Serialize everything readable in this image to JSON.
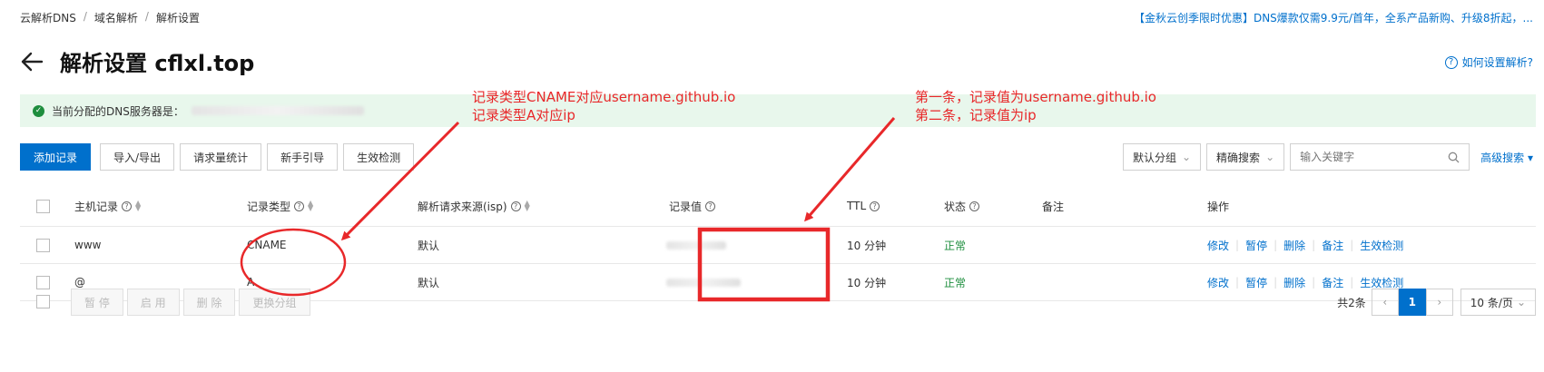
{
  "breadcrumb": [
    "云解析DNS",
    "域名解析",
    "解析设置"
  ],
  "breadcrumb_sep": "/",
  "promo": "【金秋云创季限时优惠】DNS爆款仅需9.9元/首年，全系产品新购、升级8折起，...",
  "page_title": "解析设置 cflxl.top",
  "help_link": "如何设置解析?",
  "dns_banner": {
    "text": "当前分配的DNS服务器是："
  },
  "toolbar": {
    "add": "添加记录",
    "import_export": "导入/导出",
    "request_stats": "请求量统计",
    "guide": "新手引导",
    "check": "生效检测"
  },
  "filters": {
    "group": "默认分组",
    "search_mode": "精确搜索",
    "search_placeholder": "输入关键字",
    "advanced": "高级搜索"
  },
  "table": {
    "headers": {
      "host": "主机记录",
      "type": "记录类型",
      "isp": "解析请求来源(isp)",
      "value": "记录值",
      "ttl": "TTL",
      "status": "状态",
      "remark": "备注",
      "ops": "操作"
    },
    "rows": [
      {
        "host": "www",
        "type": "CNAME",
        "isp": "默认",
        "ttl": "10 分钟",
        "status": "正常"
      },
      {
        "host": "@",
        "type": "A",
        "isp": "默认",
        "ttl": "10 分钟",
        "status": "正常"
      }
    ],
    "ops": [
      "修改",
      "暂停",
      "删除",
      "备注",
      "生效检测"
    ]
  },
  "bulk": {
    "pause": "暂 停",
    "enable": "启 用",
    "delete": "删 除",
    "regroup": "更换分组"
  },
  "pagination": {
    "total": "共2条",
    "current": "1",
    "page_size": "10 条/页"
  },
  "annotations": {
    "left_line1": "记录类型CNAME对应username.github.io",
    "left_line2": "记录类型A对应ip",
    "right_line1": "第一条，记录值为username.github.io",
    "right_line2": "第二条，记录值为ip"
  },
  "colors": {
    "accent": "#0070cc",
    "annotation": "#e8282a",
    "status_ok": "#1e8e3e",
    "banner_bg": "#e8f7ec"
  }
}
